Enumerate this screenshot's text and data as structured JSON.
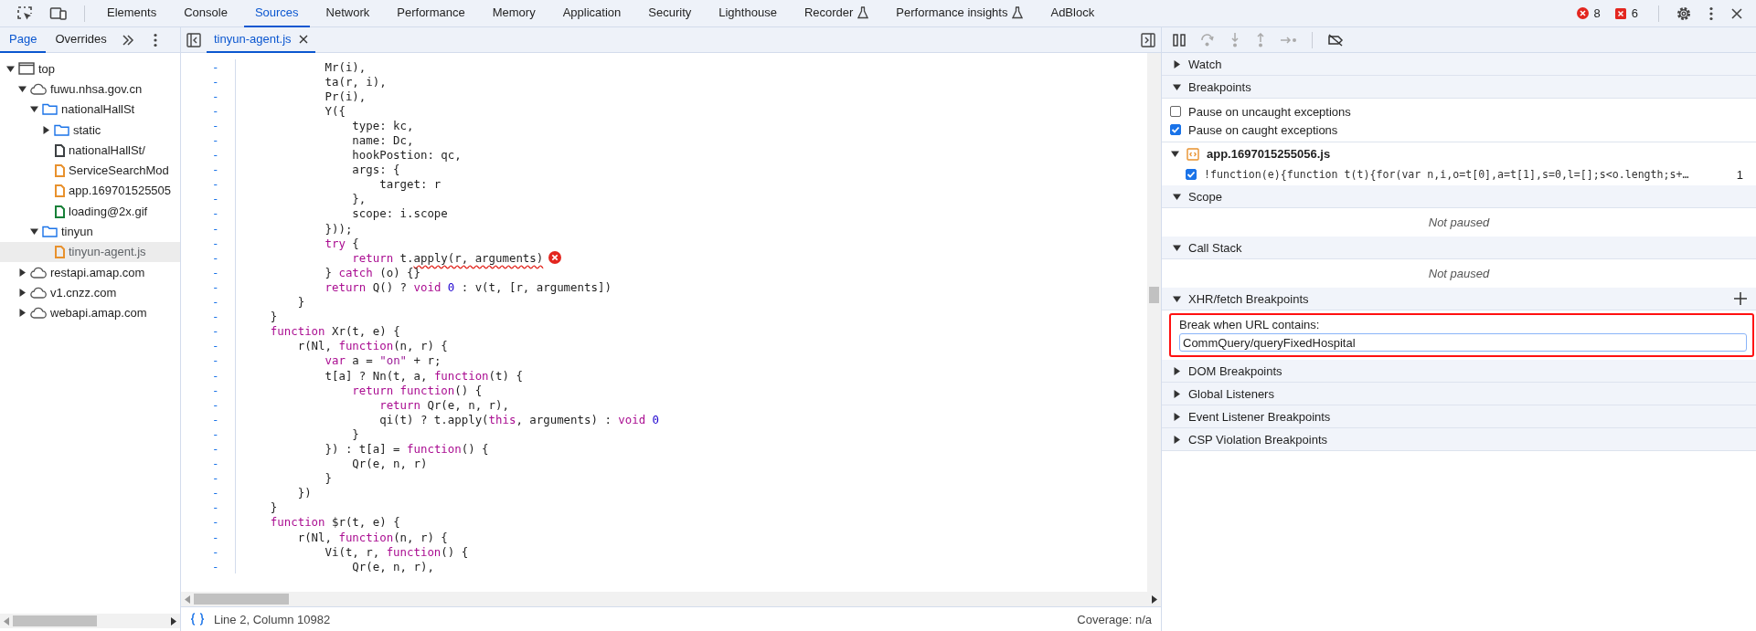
{
  "toolbar": {
    "tabs": [
      {
        "label": "Elements",
        "selected": false,
        "experimental": false
      },
      {
        "label": "Console",
        "selected": false,
        "experimental": false
      },
      {
        "label": "Sources",
        "selected": true,
        "experimental": false
      },
      {
        "label": "Network",
        "selected": false,
        "experimental": false
      },
      {
        "label": "Performance",
        "selected": false,
        "experimental": false
      },
      {
        "label": "Memory",
        "selected": false,
        "experimental": false
      },
      {
        "label": "Application",
        "selected": false,
        "experimental": false
      },
      {
        "label": "Security",
        "selected": false,
        "experimental": false
      },
      {
        "label": "Lighthouse",
        "selected": false,
        "experimental": false
      },
      {
        "label": "Recorder",
        "selected": false,
        "experimental": true
      },
      {
        "label": "Performance insights",
        "selected": false,
        "experimental": true
      },
      {
        "label": "AdBlock",
        "selected": false,
        "experimental": false
      }
    ],
    "errors": "8",
    "issues": "6"
  },
  "navigator": {
    "tabs": [
      {
        "label": "Page",
        "selected": true
      },
      {
        "label": "Overrides",
        "selected": false
      }
    ],
    "tree": [
      {
        "label": "top",
        "kind": "frame",
        "expanded": true,
        "selected": false,
        "children": [
          {
            "label": "fuwu.nhsa.gov.cn",
            "kind": "domain",
            "expanded": true,
            "selected": false,
            "children": [
              {
                "label": "nationalHallSt",
                "kind": "folder",
                "expanded": true,
                "selected": false,
                "children": [
                  {
                    "label": "static",
                    "kind": "folder",
                    "expanded": false,
                    "selected": false
                  },
                  {
                    "label": "nationalHallSt/",
                    "kind": "file",
                    "color": "#3c4043",
                    "selected": false
                  },
                  {
                    "label": "ServiceSearchMod",
                    "kind": "file",
                    "color": "#e8912d",
                    "selected": false
                  },
                  {
                    "label": "app.169701525505",
                    "kind": "file",
                    "color": "#e8912d",
                    "selected": false
                  },
                  {
                    "label": "loading@2x.gif",
                    "kind": "file",
                    "color": "#188038",
                    "selected": false
                  }
                ]
              },
              {
                "label": "tinyun",
                "kind": "folder",
                "expanded": true,
                "selected": false,
                "children": [
                  {
                    "label": "tinyun-agent.js",
                    "kind": "file",
                    "color": "#e8912d",
                    "selected": true
                  }
                ]
              }
            ]
          },
          {
            "label": "restapi.amap.com",
            "kind": "domain",
            "expanded": false,
            "selected": false
          },
          {
            "label": "v1.cnzz.com",
            "kind": "domain",
            "expanded": false,
            "selected": false
          },
          {
            "label": "webapi.amap.com",
            "kind": "domain",
            "expanded": false,
            "selected": false
          }
        ]
      }
    ]
  },
  "editor": {
    "tabs": [
      {
        "label": "tinyun-agent.js",
        "selected": true
      }
    ],
    "lines": [
      {
        "marker": "-",
        "error": false,
        "segments": [
          {
            "kind": "plain",
            "text": "            Mr(i),"
          }
        ]
      },
      {
        "marker": "-",
        "error": false,
        "segments": [
          {
            "kind": "plain",
            "text": "            ta(r, i),"
          }
        ]
      },
      {
        "marker": "-",
        "error": false,
        "segments": [
          {
            "kind": "plain",
            "text": "            Pr(i),"
          }
        ]
      },
      {
        "marker": "-",
        "error": false,
        "segments": [
          {
            "kind": "plain",
            "text": "            Y({"
          }
        ]
      },
      {
        "marker": "-",
        "error": false,
        "segments": [
          {
            "kind": "plain",
            "text": "                type: kc,"
          }
        ]
      },
      {
        "marker": "-",
        "error": false,
        "segments": [
          {
            "kind": "plain",
            "text": "                name: Dc,"
          }
        ]
      },
      {
        "marker": "-",
        "error": false,
        "segments": [
          {
            "kind": "plain",
            "text": "                hookPostion: qc,"
          }
        ]
      },
      {
        "marker": "-",
        "error": false,
        "segments": [
          {
            "kind": "plain",
            "text": "                args: {"
          }
        ]
      },
      {
        "marker": "-",
        "error": false,
        "segments": [
          {
            "kind": "plain",
            "text": "                    target: r"
          }
        ]
      },
      {
        "marker": "-",
        "error": false,
        "segments": [
          {
            "kind": "plain",
            "text": "                },"
          }
        ]
      },
      {
        "marker": "-",
        "error": false,
        "segments": [
          {
            "kind": "plain",
            "text": "                scope: i.scope"
          }
        ]
      },
      {
        "marker": "-",
        "error": false,
        "segments": [
          {
            "kind": "plain",
            "text": "            }));"
          }
        ]
      },
      {
        "marker": "-",
        "error": false,
        "segments": [
          {
            "kind": "keyword",
            "text": "            try"
          },
          {
            "kind": "plain",
            "text": " {"
          }
        ]
      },
      {
        "marker": "-",
        "error": true,
        "segments": [
          {
            "kind": "keyword",
            "text": "                return"
          },
          {
            "kind": "plain",
            "text": " t."
          },
          {
            "kind": "squiggle",
            "text": "apply(r, arguments)"
          }
        ]
      },
      {
        "marker": "-",
        "error": false,
        "segments": [
          {
            "kind": "plain",
            "text": "            } "
          },
          {
            "kind": "keyword",
            "text": "catch"
          },
          {
            "kind": "plain",
            "text": " (o) {}"
          }
        ]
      },
      {
        "marker": "-",
        "error": false,
        "segments": [
          {
            "kind": "keyword",
            "text": "            return"
          },
          {
            "kind": "plain",
            "text": " Q() ? "
          },
          {
            "kind": "keyword",
            "text": "void"
          },
          {
            "kind": "number",
            "text": " 0"
          },
          {
            "kind": "plain",
            "text": " : v(t, [r, arguments])"
          }
        ]
      },
      {
        "marker": "-",
        "error": false,
        "segments": [
          {
            "kind": "plain",
            "text": "        }"
          }
        ]
      },
      {
        "marker": "-",
        "error": false,
        "segments": [
          {
            "kind": "plain",
            "text": "    }"
          }
        ]
      },
      {
        "marker": "-",
        "error": false,
        "segments": [
          {
            "kind": "keyword",
            "text": "    function"
          },
          {
            "kind": "plain",
            "text": " Xr(t, e) {"
          }
        ]
      },
      {
        "marker": "-",
        "error": false,
        "segments": [
          {
            "kind": "plain",
            "text": "        r(Nl, "
          },
          {
            "kind": "keyword",
            "text": "function"
          },
          {
            "kind": "plain",
            "text": "(n, r) {"
          }
        ]
      },
      {
        "marker": "-",
        "error": false,
        "segments": [
          {
            "kind": "keyword",
            "text": "            var"
          },
          {
            "kind": "plain",
            "text": " a = "
          },
          {
            "kind": "string",
            "text": "\"on\""
          },
          {
            "kind": "plain",
            "text": " + r;"
          }
        ]
      },
      {
        "marker": "-",
        "error": false,
        "segments": [
          {
            "kind": "plain",
            "text": "            t[a] ? Nn(t, a, "
          },
          {
            "kind": "keyword",
            "text": "function"
          },
          {
            "kind": "plain",
            "text": "(t) {"
          }
        ]
      },
      {
        "marker": "-",
        "error": false,
        "segments": [
          {
            "kind": "keyword",
            "text": "                return"
          },
          {
            "kind": "keyword",
            "text": " function"
          },
          {
            "kind": "plain",
            "text": "() {"
          }
        ]
      },
      {
        "marker": "-",
        "error": false,
        "segments": [
          {
            "kind": "keyword",
            "text": "                    return"
          },
          {
            "kind": "plain",
            "text": " Qr(e, n, r),"
          }
        ]
      },
      {
        "marker": "-",
        "error": false,
        "segments": [
          {
            "kind": "plain",
            "text": "                    qi(t) ? t.apply("
          },
          {
            "kind": "keyword",
            "text": "this"
          },
          {
            "kind": "plain",
            "text": ", arguments) : "
          },
          {
            "kind": "keyword",
            "text": "void"
          },
          {
            "kind": "number",
            "text": " 0"
          }
        ]
      },
      {
        "marker": "-",
        "error": false,
        "segments": [
          {
            "kind": "plain",
            "text": "                }"
          }
        ]
      },
      {
        "marker": "-",
        "error": false,
        "segments": [
          {
            "kind": "plain",
            "text": "            }) : t[a] = "
          },
          {
            "kind": "keyword",
            "text": "function"
          },
          {
            "kind": "plain",
            "text": "() {"
          }
        ]
      },
      {
        "marker": "-",
        "error": false,
        "segments": [
          {
            "kind": "plain",
            "text": "                Qr(e, n, r)"
          }
        ]
      },
      {
        "marker": "-",
        "error": false,
        "segments": [
          {
            "kind": "plain",
            "text": "            }"
          }
        ]
      },
      {
        "marker": "-",
        "error": false,
        "segments": [
          {
            "kind": "plain",
            "text": "        })"
          }
        ]
      },
      {
        "marker": "-",
        "error": false,
        "segments": [
          {
            "kind": "plain",
            "text": "    }"
          }
        ]
      },
      {
        "marker": "-",
        "error": false,
        "segments": [
          {
            "kind": "keyword",
            "text": "    function"
          },
          {
            "kind": "plain",
            "text": " $r(t, e) {"
          }
        ]
      },
      {
        "marker": "-",
        "error": false,
        "segments": [
          {
            "kind": "plain",
            "text": "        r(Nl, "
          },
          {
            "kind": "keyword",
            "text": "function"
          },
          {
            "kind": "plain",
            "text": "(n, r) {"
          }
        ]
      },
      {
        "marker": "-",
        "error": false,
        "segments": [
          {
            "kind": "plain",
            "text": "            Vi(t, r, "
          },
          {
            "kind": "keyword",
            "text": "function"
          },
          {
            "kind": "plain",
            "text": "() {"
          }
        ]
      },
      {
        "marker": "-",
        "error": false,
        "segments": [
          {
            "kind": "plain",
            "text": "                Qr(e, n, r),"
          }
        ]
      }
    ],
    "status": "Line 2, Column 10982",
    "coverage": "Coverage: n/a"
  },
  "debugger": {
    "sections": [
      {
        "title": "Watch",
        "kind": "plain",
        "expanded": false
      },
      {
        "title": "Breakpoints",
        "kind": "breakpoints",
        "expanded": true,
        "options": [
          {
            "label": "Pause on uncaught exceptions",
            "checked": false
          },
          {
            "label": "Pause on caught exceptions",
            "checked": true
          }
        ],
        "files": [
          {
            "name": "app.1697015255056.js",
            "expanded": true,
            "breakpoints": [
              {
                "code": "!function(e){function t(t){for(var n,i,o=t[0],a=t[1],s=0,l=[];s<o.length;s+…",
                "line": "1",
                "checked": true
              }
            ]
          }
        ]
      },
      {
        "title": "Scope",
        "kind": "message",
        "expanded": true,
        "message": "Not paused"
      },
      {
        "title": "Call Stack",
        "kind": "message",
        "expanded": true,
        "message": "Not paused"
      },
      {
        "title": "XHR/fetch Breakpoints",
        "kind": "xhr",
        "expanded": true,
        "label": "Break when URL contains:",
        "value": "CommQuery/queryFixedHospital",
        "highlighted": true
      },
      {
        "title": "DOM Breakpoints",
        "kind": "plain",
        "expanded": false
      },
      {
        "title": "Global Listeners",
        "kind": "plain",
        "expanded": false
      },
      {
        "title": "Event Listener Breakpoints",
        "kind": "plain",
        "expanded": false
      },
      {
        "title": "CSP Violation Breakpoints",
        "kind": "plain",
        "expanded": false
      }
    ]
  }
}
